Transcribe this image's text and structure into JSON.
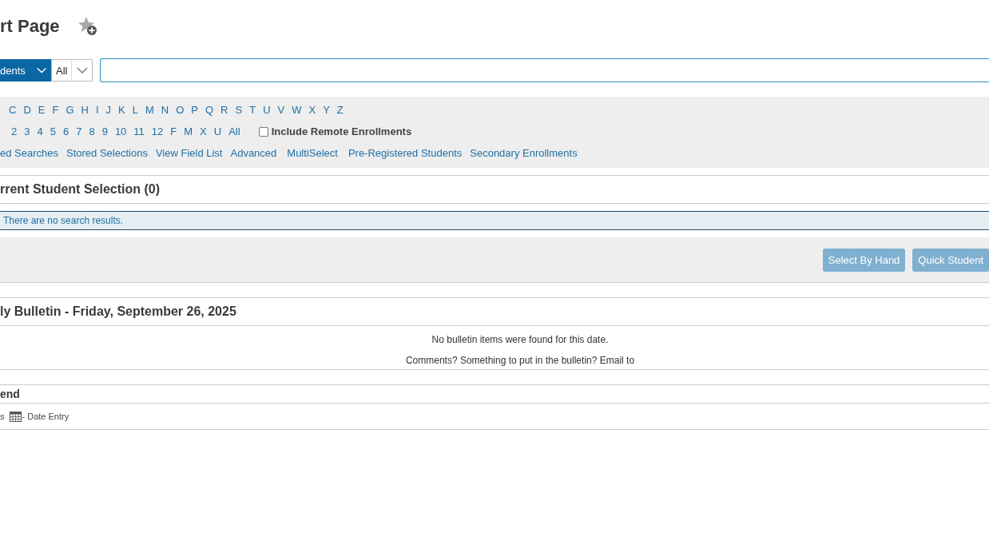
{
  "header": {
    "title": "rt Page"
  },
  "search": {
    "category": "dents",
    "scope": "All"
  },
  "letters": [
    "C",
    "D",
    "E",
    "F",
    "G",
    "H",
    "I",
    "J",
    "K",
    "L",
    "M",
    "N",
    "O",
    "P",
    "Q",
    "R",
    "S",
    "T",
    "U",
    "V",
    "W",
    "X",
    "Y",
    "Z"
  ],
  "grades": [
    "2",
    "3",
    "4",
    "5",
    "6",
    "7",
    "8",
    "9",
    "10",
    "11",
    "12",
    "F",
    "M",
    "X",
    "U",
    "All"
  ],
  "include_remote": {
    "label": "Include Remote Enrollments",
    "checked": false
  },
  "links": [
    "ed Searches",
    "Stored Selections",
    "View Field List",
    "Advanced",
    "MultiSelect",
    "Pre-Registered Students",
    "Secondary Enrollments"
  ],
  "selection": {
    "title": "rrent Student Selection (0)",
    "message": "There are no search results.",
    "buttons": [
      "Select By Hand",
      "Quick Student"
    ]
  },
  "bulletin": {
    "title": "ly Bulletin - Friday, September 26, 2025",
    "lines": [
      "No bulletin items were found for this date.",
      "Comments? Something to put in the bulletin? Email to"
    ]
  },
  "legend": {
    "title": "end",
    "items": [
      {
        "kind": "text",
        "label": "s"
      },
      {
        "kind": "calendar",
        "label": "- Date Entry"
      }
    ]
  }
}
